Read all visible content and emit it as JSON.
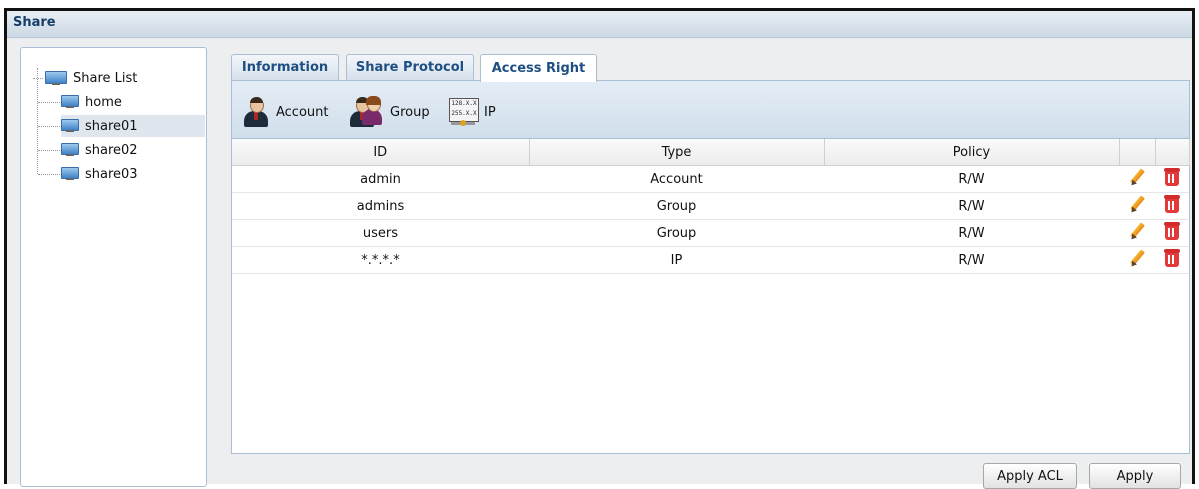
{
  "window": {
    "title": "Share"
  },
  "tree": {
    "root": {
      "label": "Share List",
      "icon": "monitor-icon"
    },
    "items": [
      {
        "label": "home",
        "selected": false
      },
      {
        "label": "share01",
        "selected": true
      },
      {
        "label": "share02",
        "selected": false
      },
      {
        "label": "share03",
        "selected": false
      }
    ]
  },
  "tabs": [
    {
      "label": "Information",
      "active": false
    },
    {
      "label": "Share Protocol",
      "active": false
    },
    {
      "label": "Access Right",
      "active": true
    }
  ],
  "toolbar": {
    "account": {
      "label": "Account",
      "icon": "account-user-icon"
    },
    "group": {
      "label": "Group",
      "icon": "group-users-icon"
    },
    "ip": {
      "label": "IP",
      "icon": "ip-address-icon",
      "icon_text_top": "128.X.X",
      "icon_text_bottom": "255.X.X"
    }
  },
  "table": {
    "columns": [
      "ID",
      "Type",
      "Policy",
      "",
      ""
    ],
    "rows": [
      {
        "id": "admin",
        "type": "Account",
        "policy": "R/W"
      },
      {
        "id": "admins",
        "type": "Group",
        "policy": "R/W"
      },
      {
        "id": "users",
        "type": "Group",
        "policy": "R/W"
      },
      {
        "id": "*.*.*.*",
        "type": "IP",
        "policy": "R/W"
      }
    ]
  },
  "buttons": {
    "apply_acl": "Apply ACL",
    "apply": "Apply"
  },
  "colors": {
    "title_text": "#173e6b",
    "tab_text": "#1f4f82",
    "border": "#a9bfd6",
    "delete_icon": "#e23a3a",
    "edit_icon": "#f7b733"
  }
}
